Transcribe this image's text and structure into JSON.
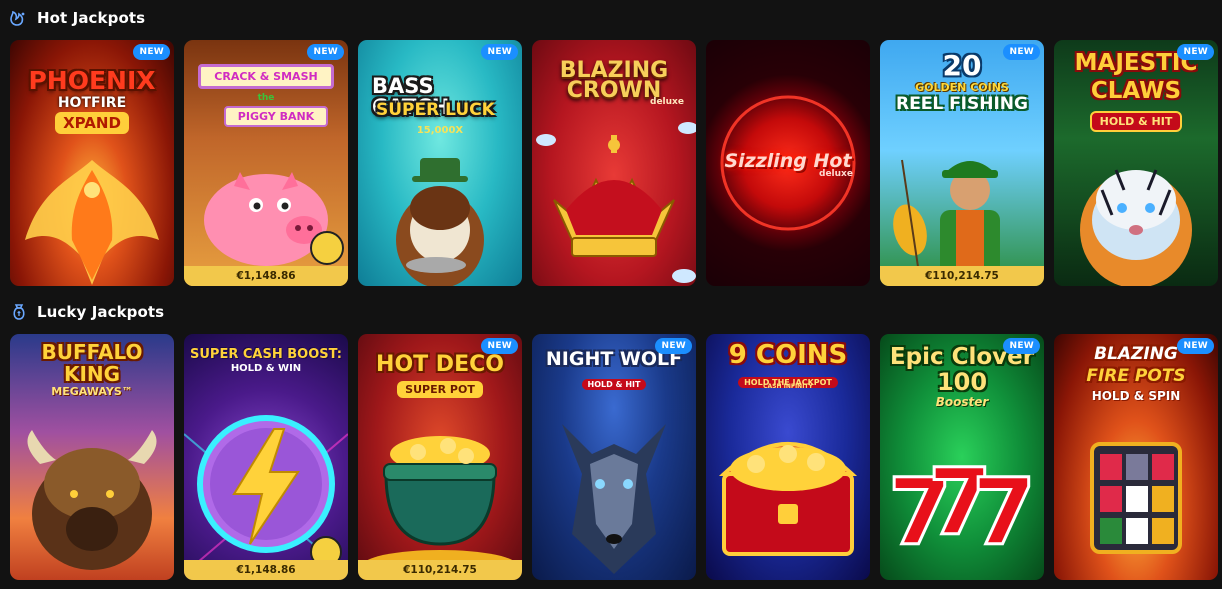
{
  "sections": {
    "hot": {
      "title": "Hot Jackpots",
      "icon": "fire-dragon-icon",
      "games": [
        {
          "title_line1": "PHOENIX",
          "title_line2": "HOTFIRE",
          "title_line3": "XPAND",
          "badge": "NEW",
          "jackpot": null
        },
        {
          "title_line1": "CRACK & SMASH",
          "title_line2": "the",
          "title_line3": "PIGGY BANK",
          "badge": "NEW",
          "jackpot": "€1,148.86"
        },
        {
          "title_line1": "BASS CATCH",
          "title_line2": "SUPER LUCK",
          "title_line3": "15,000X",
          "badge": "NEW",
          "jackpot": null
        },
        {
          "title_line1": "BLAZING",
          "title_line2": "CROWN",
          "title_line3": "deluxe",
          "badge": null,
          "jackpot": null
        },
        {
          "title_line1": "Sizzling Hot",
          "title_line2": "deluxe",
          "badge": null,
          "jackpot": null
        },
        {
          "title_line1": "20",
          "title_line2": "GOLDEN COINS",
          "title_line3": "REEL FISHING",
          "badge": "NEW",
          "jackpot": "€110,214.75"
        },
        {
          "title_line1": "MAJESTIC",
          "title_line2": "CLAWS",
          "title_line3": "HOLD & HIT",
          "badge": "NEW",
          "jackpot": null
        }
      ]
    },
    "lucky": {
      "title": "Lucky Jackpots",
      "icon": "money-bag-icon",
      "games": [
        {
          "title_line1": "BUFFALO",
          "title_line2": "KING",
          "title_line3": "MEGAWAYS™",
          "badge": null,
          "jackpot": null
        },
        {
          "title_line1": "SUPER CASH BOOST:",
          "title_line2": "HOLD & WIN",
          "badge": null,
          "jackpot": "€1,148.86"
        },
        {
          "title_line1": "HOT DECO",
          "title_line2": "SUPER POT",
          "badge": "NEW",
          "jackpot": "€110,214.75"
        },
        {
          "title_line1": "NIGHT WOLF",
          "title_line2": "HOLD & HIT",
          "badge": "NEW",
          "jackpot": null
        },
        {
          "title_line1": "9 COINS",
          "title_line2": "HOLD THE JACKPOT",
          "title_line3": "CASH INFINITY",
          "badge": null,
          "jackpot": null
        },
        {
          "title_line1": "Epic Clover",
          "title_line2": "100",
          "title_line3": "Booster",
          "badge": "NEW",
          "jackpot": null
        },
        {
          "title_line1": "BLAZING",
          "title_line2": "FIRE POTS",
          "title_line3": "HOLD & SPIN",
          "badge": "NEW",
          "jackpot": null
        }
      ]
    }
  },
  "colors": {
    "background": "#121212",
    "badge": "#1b8fff",
    "jackpot_bar": "#f2c84b"
  }
}
